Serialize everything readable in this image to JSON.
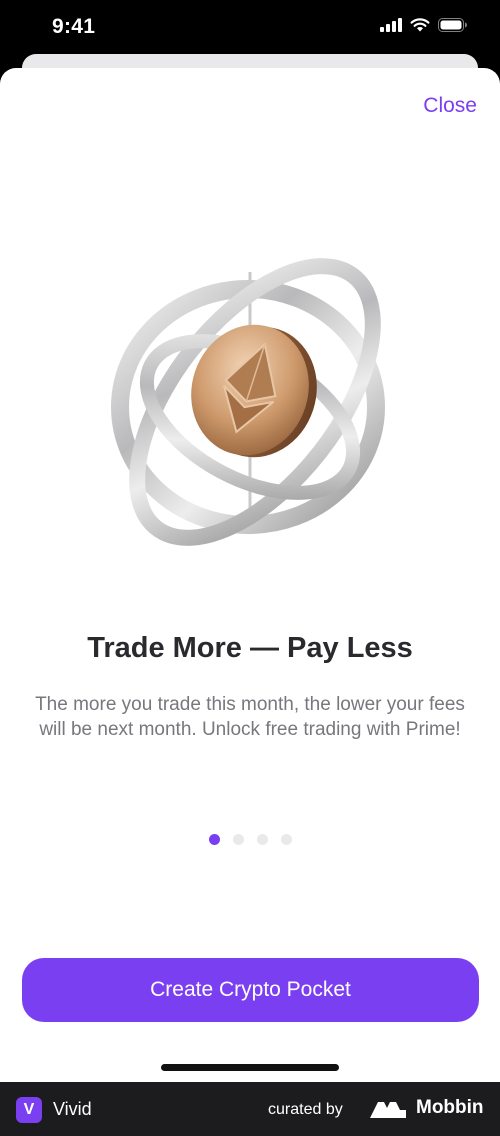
{
  "status_bar": {
    "time": "9:41",
    "icons": [
      "cellular-signal-icon",
      "wifi-icon",
      "battery-icon"
    ]
  },
  "sheet": {
    "close_label": "Close",
    "hero_icon": "ethereum-coin-with-orbit-rings-illustration",
    "title": "Trade More — Pay Less",
    "description": "The more you trade this month, the lower your fees will be next month. Unlock free trading with Prime!",
    "pagination": {
      "total": 4,
      "active_index": 0
    },
    "cta_label": "Create Crypto Pocket"
  },
  "footer": {
    "app_badge": "V",
    "app_name": "Vivid",
    "curated_label": "curated by",
    "brand_name": "Mobbin"
  },
  "colors": {
    "accent": "#7b3ff2",
    "title": "#2a2a2e",
    "body_text": "#77777d",
    "footer_bg": "#1c1c1e"
  }
}
